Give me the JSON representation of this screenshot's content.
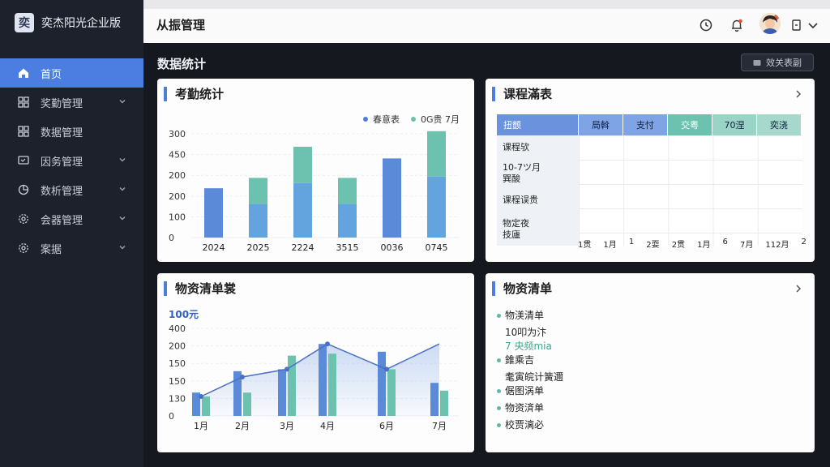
{
  "app": {
    "logo_char": "奕",
    "name": "奕杰阳光企业版"
  },
  "sidebar": {
    "items": [
      {
        "label": "首页",
        "icon": "home-icon",
        "active": true,
        "chevron": false
      },
      {
        "label": "奖勤管理",
        "icon": "grid-icon",
        "chevron": true
      },
      {
        "label": "数据管理",
        "icon": "grid-icon",
        "chevron": false
      },
      {
        "label": "因务管理",
        "icon": "monitor-icon",
        "chevron": true
      },
      {
        "label": "数析管理",
        "icon": "pie-icon",
        "chevron": true
      },
      {
        "label": "会器管理",
        "icon": "gear-icon",
        "chevron": true
      },
      {
        "label": "案据",
        "icon": "gear-icon",
        "chevron": true
      }
    ]
  },
  "header": {
    "title": "从振管理"
  },
  "page": {
    "title": "数据统计",
    "top_button": "效关表副"
  },
  "colors": {
    "accent": "#4b7ee0",
    "teal": "#6cc2ae",
    "blue_light": "#63a4de"
  },
  "attendance": {
    "title": "考勤统计",
    "legend": [
      "春意表",
      "0G贵 7月"
    ],
    "chart_data": {
      "type": "bar",
      "title": "考勤统计",
      "y_ticks": [
        "300",
        "450",
        "200",
        "200",
        "100",
        "0"
      ],
      "categories": [
        "2024",
        "2025",
        "2224",
        "3515",
        "0036",
        "0745"
      ],
      "series": [
        {
          "name": "春意表",
          "values": [
            190,
            130,
            210,
            130,
            305,
            235
          ]
        },
        {
          "name": "0G贵 7月",
          "values": [
            0,
            100,
            140,
            100,
            0,
            175
          ]
        }
      ],
      "ylim": [
        0,
        400
      ]
    }
  },
  "timetable": {
    "title": "课程滿表",
    "headers": [
      "扭颤",
      "局斡",
      "支忖",
      "交粤",
      "70涅",
      "奕浇"
    ],
    "rows": [
      [
        "课程欤"
      ],
      [
        "10-7ツ月",
        "巽酸"
      ],
      [
        "课程误贵"
      ],
      [
        "物定夜",
        "技廬"
      ]
    ],
    "footer": [
      "1贯",
      "1月",
      "1",
      "2耍",
      "2贯",
      "1月",
      "6",
      "7月",
      "112月",
      "2"
    ]
  },
  "materials": {
    "title": "物资清单裳",
    "unit_label": "100元",
    "chart_data": {
      "type": "bar",
      "y_ticks": [
        "400",
        "200",
        "150",
        "150",
        "130",
        "0"
      ],
      "categories": [
        "1月",
        "2月",
        "3月",
        "4月",
        "6月",
        "7月"
      ],
      "series": [
        {
          "name": "",
          "values": [
            60,
            115,
            120,
            185,
            165,
            85
          ]
        },
        {
          "name": "",
          "values": [
            50,
            60,
            155,
            160,
            120,
            65
          ]
        },
        {
          "name": "",
          "values": [
            50,
            100,
            120,
            185,
            120,
            185
          ]
        }
      ],
      "ylim": [
        0,
        225
      ]
    }
  },
  "material_list": {
    "title": "物资清单",
    "items": [
      {
        "text": "物渼清单",
        "dot": true
      },
      {
        "text": "10叩为汴",
        "dot": false
      },
      {
        "text": "7 央频mia",
        "dot": false,
        "teal": true
      },
      {
        "text": "錐乘吉",
        "dot": true
      },
      {
        "text": "耄寅皖计簧邇",
        "dot": false
      },
      {
        "text": "倨图涡单",
        "dot": true
      },
      {
        "text": "物资済单",
        "dot": true
      },
      {
        "text": "校贾漓必",
        "dot": true
      }
    ]
  }
}
